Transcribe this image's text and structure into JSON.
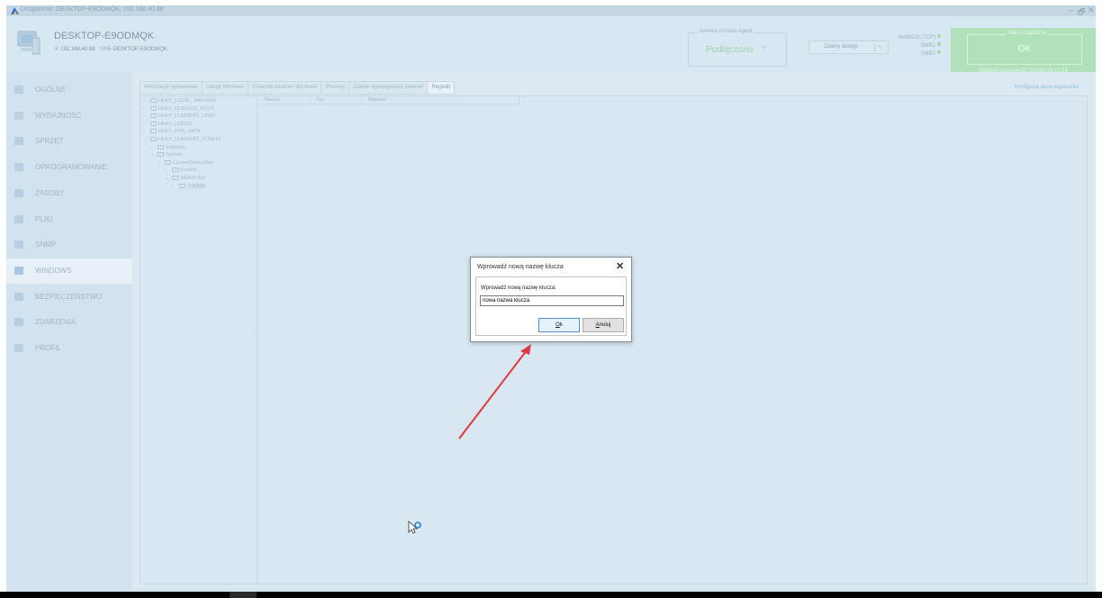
{
  "window": {
    "title": "Urządzenie: DESKTOP-E9ODMQK, 192.168.40.88",
    "controls": [
      "–",
      "🗗",
      "✕"
    ]
  },
  "header": {
    "device_name": "DESKTOP-E9ODMQK",
    "ip_label": "IP",
    "ip": "192.168.40.88",
    "smb_label": "SMB",
    "smb_name": "DESKTOP-E9ODMQK",
    "agent_label": "Axence nVision Agent",
    "agent_status": "Podłączono",
    "agent_help": "?",
    "remote_access": "Zdalny dostęp",
    "netbios": [
      "NetBIOS (TCP)",
      "SMB2",
      "SMB2"
    ],
    "state_label": "Stan urządzenia",
    "state_value": "OK",
    "last_update": "Ostatnia odpowiedź: Dzisiaj 15:13:24"
  },
  "sidebar": {
    "items": [
      {
        "label": "OGÓLNE",
        "icon": "monitor-icon"
      },
      {
        "label": "WYDAJNOŚĆ",
        "icon": "gauge-icon"
      },
      {
        "label": "SPRZĘT",
        "icon": "screen-icon"
      },
      {
        "label": "OPROGRAMOWANIE",
        "icon": "window-icon"
      },
      {
        "label": "ZASOBY",
        "icon": "network-icon"
      },
      {
        "label": "PLIKI",
        "icon": "file-icon"
      },
      {
        "label": "SNMP",
        "icon": "table-icon"
      },
      {
        "label": "WINDOWS",
        "icon": "windows-icon"
      },
      {
        "label": "BEZPIECZEŃSTWO",
        "icon": "shield-icon"
      },
      {
        "label": "ZDARZENIA",
        "icon": "calendar-icon"
      },
      {
        "label": "PROFIL",
        "icon": "profile-icon"
      }
    ],
    "active_index": 7
  },
  "tabs": [
    "Informacje systemowe",
    "Usługi Windows",
    "Dziennik zdarzeń Windows",
    "Procesy",
    "Zdalne wykonywanie poleceń",
    "Regedit"
  ],
  "active_tab": 5,
  "config_link": "Konfiguruj dane logowania",
  "tree": [
    {
      "label": "HKEY_LOCAL_MACHINE",
      "chev": "›"
    },
    {
      "label": "HKEY_CLASSES_ROOT",
      "chev": "›"
    },
    {
      "label": "HKEY_CURRENT_USER",
      "chev": "›"
    },
    {
      "label": "HKEY_USERS",
      "chev": "›"
    },
    {
      "label": "HKEY_DYN_DATA",
      "chev": "›"
    },
    {
      "label": "HKEY_CURRENT_CONFIG",
      "chev": "⌄"
    },
    {
      "label": "Software",
      "chev": "›"
    },
    {
      "label": "System",
      "chev": "⌄"
    },
    {
      "label": "CurrentControlSet",
      "chev": "⌄"
    },
    {
      "label": "Control",
      "chev": "›"
    },
    {
      "label": "SERVICES",
      "chev": "⌄"
    },
    {
      "label": "TSDDD",
      "chev": "›"
    }
  ],
  "grid_columns": [
    "Nazwa",
    "Typ",
    "Wartość"
  ],
  "dialog": {
    "title": "Wprowadź nową nazwę klucza",
    "close": "✕",
    "prompt": "Wprowadź nową nazwę klucza:",
    "value": "nowa nazwa klucza",
    "ok_underlined": "O",
    "ok_rest": "k",
    "cancel_underlined": "A",
    "cancel_rest": "nuluj"
  },
  "colors": {
    "accent_arrow": "#e0393e",
    "status_ok": "#b0e1bb",
    "link": "#8fc0e3"
  }
}
